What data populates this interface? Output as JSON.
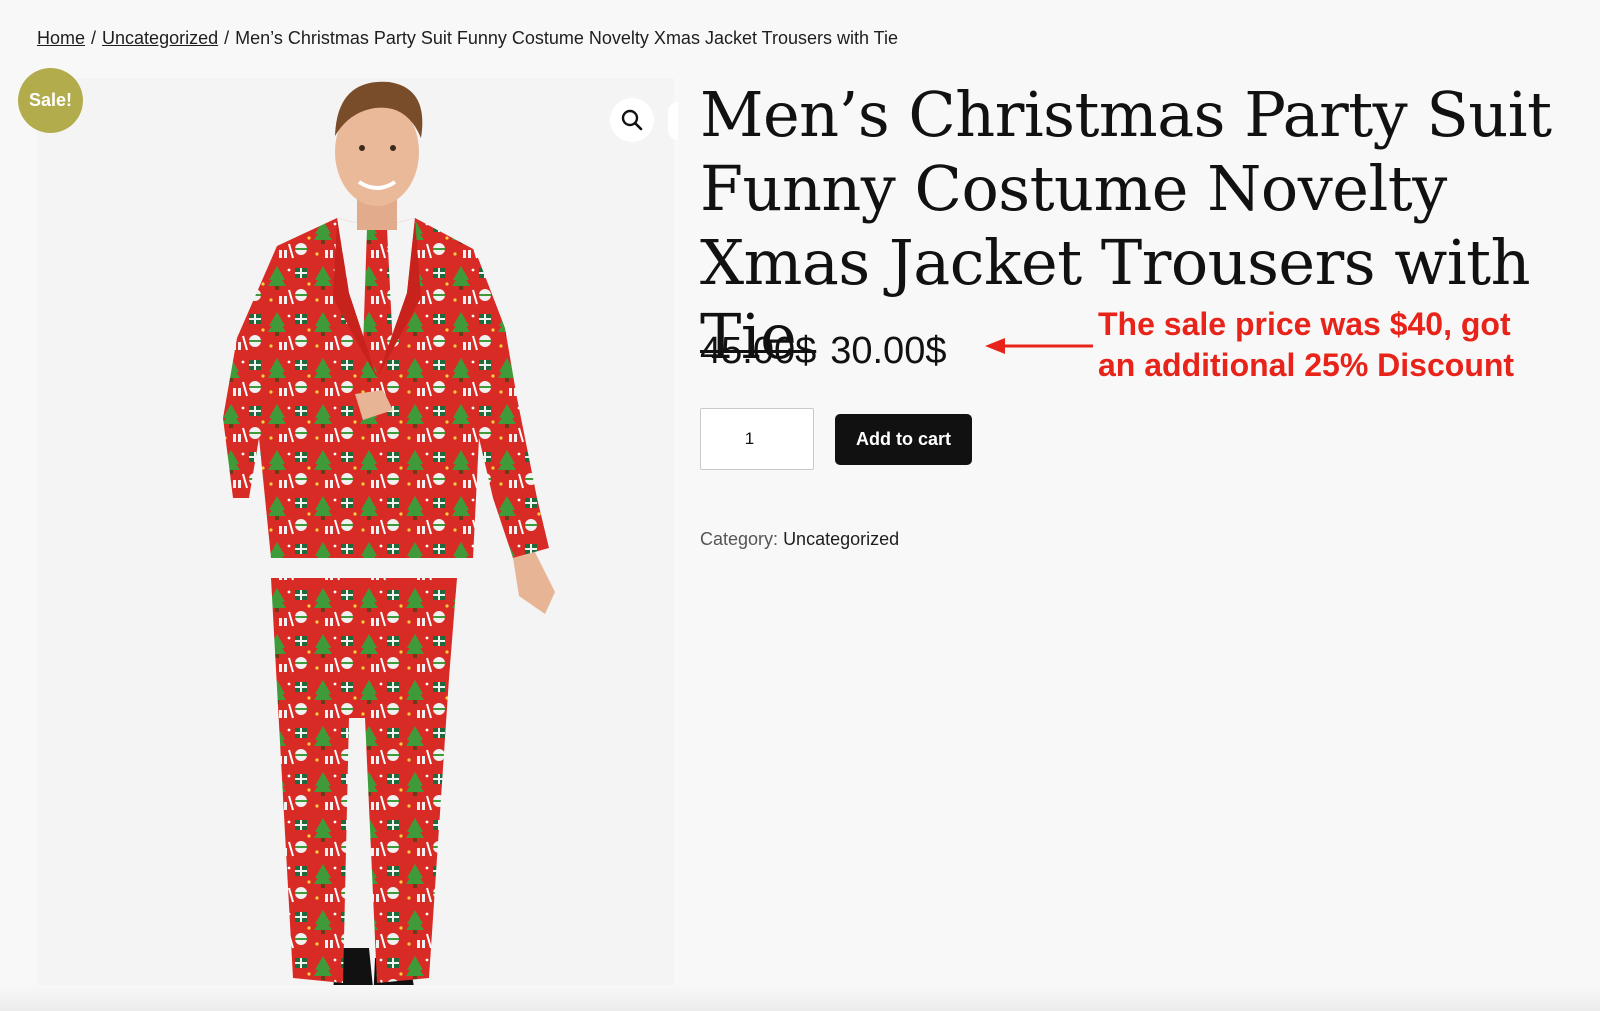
{
  "breadcrumb": {
    "home": "Home",
    "separator": "/",
    "category": "Uncategorized",
    "current": "Men’s Christmas Party Suit Funny Costume Novelty Xmas Jacket Trousers with Tie"
  },
  "gallery": {
    "badge": "Sale!",
    "zoom_icon": "search-icon"
  },
  "product": {
    "title": "Men’s Christmas Party Suit Funny Costume Novelty Xmas Jacket Trousers with Tie",
    "regular_price": "45.00$",
    "sale_price": "30.00$",
    "quantity": "1",
    "add_to_cart_label": "Add to cart",
    "category_label": "Category:",
    "category_value": "Uncategorized"
  },
  "annotation": {
    "line1": "The sale price was $40, got",
    "line2": "an additional 25% Discount",
    "color": "#e8231a"
  },
  "colors": {
    "badge": "#b2ac4d",
    "button": "#111111",
    "suit_red": "#d92b26",
    "suit_green": "#3f9b3a"
  }
}
